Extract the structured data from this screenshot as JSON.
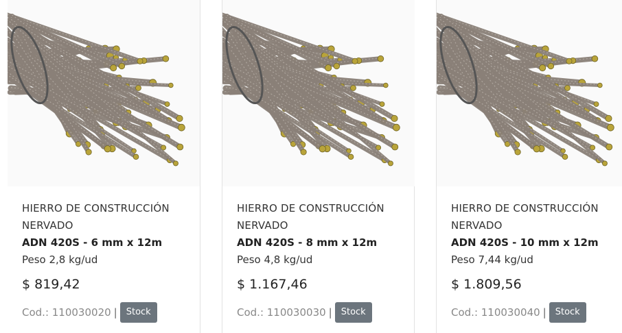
{
  "products": [
    {
      "title": "HIERRO DE CONSTRUCCIÓN NERVADO",
      "subtitle": "ADN 420S - 6 mm x 12m",
      "weight": "Peso 2,8 kg/ud",
      "price": "$ 819,42",
      "code": "Cod.: 110030020",
      "stock_label": "Stock"
    },
    {
      "title": "HIERRO DE CONSTRUCCIÓN NERVADO",
      "subtitle": "ADN 420S - 8 mm x 12m",
      "weight": "Peso 4,8 kg/ud",
      "price": "$ 1.167,46",
      "code": "Cod.: 110030030",
      "stock_label": "Stock"
    },
    {
      "title": "HIERRO DE CONSTRUCCIÓN NERVADO",
      "subtitle": "ADN 420S - 10 mm x 12m",
      "weight": "Peso 7,44 kg/ud",
      "price": "$ 1.809,56",
      "code": "Cod.: 110030040",
      "stock_label": "Stock"
    }
  ],
  "separator": "|",
  "colors": {
    "stock_button": "#6c757d",
    "rebar_steel": "#8a8078",
    "rebar_ends": "#b9a43a"
  },
  "icons": {
    "product_image": "rebar-bundle-image"
  }
}
